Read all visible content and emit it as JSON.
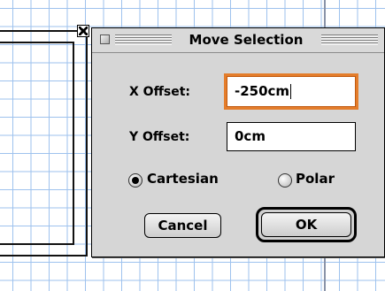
{
  "dialog": {
    "title": "Move Selection",
    "x_offset": {
      "label": "X Offset:",
      "value": "-250cm"
    },
    "y_offset": {
      "label": "Y Offset:",
      "value": "0cm"
    },
    "mode": {
      "options": [
        "Cartesian",
        "Polar"
      ],
      "selected": "Cartesian"
    },
    "buttons": {
      "cancel": "Cancel",
      "ok": "OK"
    }
  },
  "colors": {
    "grid_line": "#9ec2ee",
    "focus_ring": "#e47d2b",
    "dialog_bg": "#d6d6d6"
  }
}
